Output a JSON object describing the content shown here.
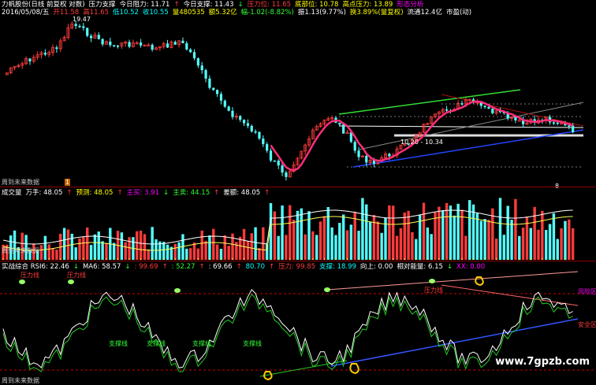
{
  "main_header": {
    "line1": [
      {
        "text": "力帆股份(日线 前复权 对数)",
        "color": "w"
      },
      {
        "text": "压力支撑",
        "color": "w"
      },
      {
        "text": "今日阻力: 11.71",
        "color": "w"
      },
      {
        "text": "↑",
        "color": "r"
      },
      {
        "text": "今日支撑: 11.43",
        "color": "w"
      },
      {
        "text": "↓",
        "color": "g"
      },
      {
        "text": "压力位: 11.65",
        "color": "r"
      },
      {
        "text": "底部位: 10.78",
        "color": "y"
      },
      {
        "text": "高点压力: 13.89",
        "color": "y"
      },
      {
        "text": "形态分析",
        "color": "m"
      }
    ],
    "line2": [
      {
        "text": "2016/05/08/五",
        "color": "w"
      },
      {
        "text": "开11.58",
        "color": "r"
      },
      {
        "text": "高11.65",
        "color": "r"
      },
      {
        "text": "低10.52",
        "color": "c"
      },
      {
        "text": "收10.55",
        "color": "c"
      },
      {
        "text": "量480535",
        "color": "y"
      },
      {
        "text": "额5.32亿",
        "color": "y"
      },
      {
        "text": "幅-1.02(-8.82%)",
        "color": "g"
      },
      {
        "text": "振1.13(9.77%)",
        "color": "w"
      },
      {
        "text": "换3.89%(量复权)",
        "color": "y"
      },
      {
        "text": "流通12.4亿",
        "color": "w"
      },
      {
        "text": "市盈(动)",
        "color": "w"
      }
    ]
  },
  "main_chart": {
    "high_label": "19.47",
    "range_label": "10.20 - 10.34",
    "future_text": "周到未来数据",
    "marker_label": "1",
    "end_marker": "8"
  },
  "volume_header": [
    {
      "text": "成交量",
      "color": "w"
    },
    {
      "text": "万手: 48.05",
      "color": "w"
    },
    {
      "text": "↑",
      "color": "r"
    },
    {
      "text": "预测: 48.05",
      "color": "y"
    },
    {
      "text": "↑",
      "color": "r"
    },
    {
      "text": "主买: 3.91",
      "color": "m"
    },
    {
      "text": "↓",
      "color": "g"
    },
    {
      "text": "主卖: 44.15",
      "color": "g"
    },
    {
      "text": "↑",
      "color": "r"
    },
    {
      "text": "差额: 48.05",
      "color": "w"
    },
    {
      "text": "↑",
      "color": "r"
    }
  ],
  "volume_future_text": "周到未来数据",
  "indicator_header": [
    {
      "text": "实战综合 RSI6: 22.46",
      "color": "w"
    },
    {
      "text": "↓",
      "color": "g"
    },
    {
      "text": "MA6: 58.57",
      "color": "w"
    },
    {
      "text": "↓",
      "color": "g"
    },
    {
      "text": ": 99.69",
      "color": "r"
    },
    {
      "text": "↑",
      "color": "r"
    },
    {
      "text": ": 52.27",
      "color": "g"
    },
    {
      "text": "↑",
      "color": "r"
    },
    {
      "text": ": 69.66",
      "color": "w"
    },
    {
      "text": "↑",
      "color": "r"
    },
    {
      "text": "80.70",
      "color": "c"
    },
    {
      "text": "↑",
      "color": "r"
    },
    {
      "text": "压力: 99.85",
      "color": "r"
    },
    {
      "text": "支撑: 18.99",
      "color": "c"
    },
    {
      "text": "向上: 0.00",
      "color": "w"
    },
    {
      "text": "相对能量: 6.15",
      "color": "w"
    },
    {
      "text": "↓",
      "color": "g"
    },
    {
      "text": "XX: 0.00",
      "color": "m"
    }
  ],
  "indicator_labels": {
    "pressure1": "压力线",
    "pressure2": "压力线",
    "pressure3": "压力线",
    "support1": "支撑线",
    "support2": "支撑线",
    "support3": "支撑线",
    "support4": "支撑线",
    "risk": "风险区",
    "safe": "安全区",
    "future": "周到未来数据"
  },
  "watermark": "www.7gpzb.com",
  "colors": {
    "up": "#ff3b3b",
    "down": "#54ffff",
    "ma_pink": "#ff2e7a",
    "trend_green": "#33dd33",
    "trend_blue": "#2244ff",
    "panel_sep": "#8a0000"
  }
}
